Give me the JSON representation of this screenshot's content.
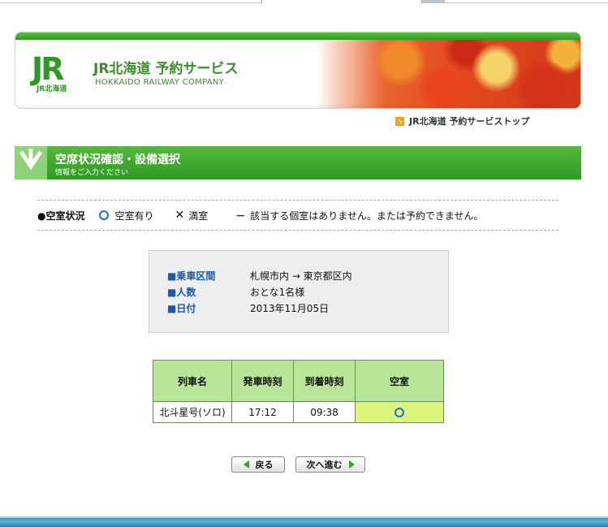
{
  "header": {
    "logo_text": "JR",
    "logo_sub": "JR北海道",
    "brand": "JR北海道 予約サービス",
    "brand_en": "HOKKAIDO RAILWAY COMPANY",
    "top_link": "JR北海道 予約サービストップ"
  },
  "section": {
    "title": "空席状況確認・設備選択",
    "subtitle": "情報をご入力ください"
  },
  "legend": {
    "label": "●空室状況",
    "available": "空室有り",
    "full": "満室",
    "none_symbol": "－",
    "none": "該当する個室はありません。または予約できません。"
  },
  "info": {
    "route_label": "■乗車区間",
    "route_value": "札幌市内 → 東京都区内",
    "people_label": "■人数",
    "people_value": "おとな1名様",
    "date_label": "■日付",
    "date_value": "2013年11月05日"
  },
  "table": {
    "headers": [
      "列車名",
      "発車時刻",
      "到着時刻",
      "空室"
    ],
    "rows": [
      {
        "train": "北斗星号(ソロ)",
        "depart": "17:12",
        "arrive": "09:38",
        "availability": "available"
      }
    ]
  },
  "buttons": {
    "back": "戻る",
    "next": "次へ進む"
  },
  "colors": {
    "brand_green": "#2e9a24",
    "available_blue": "#1a6fd0",
    "avail_cell": "#ddf37a"
  }
}
